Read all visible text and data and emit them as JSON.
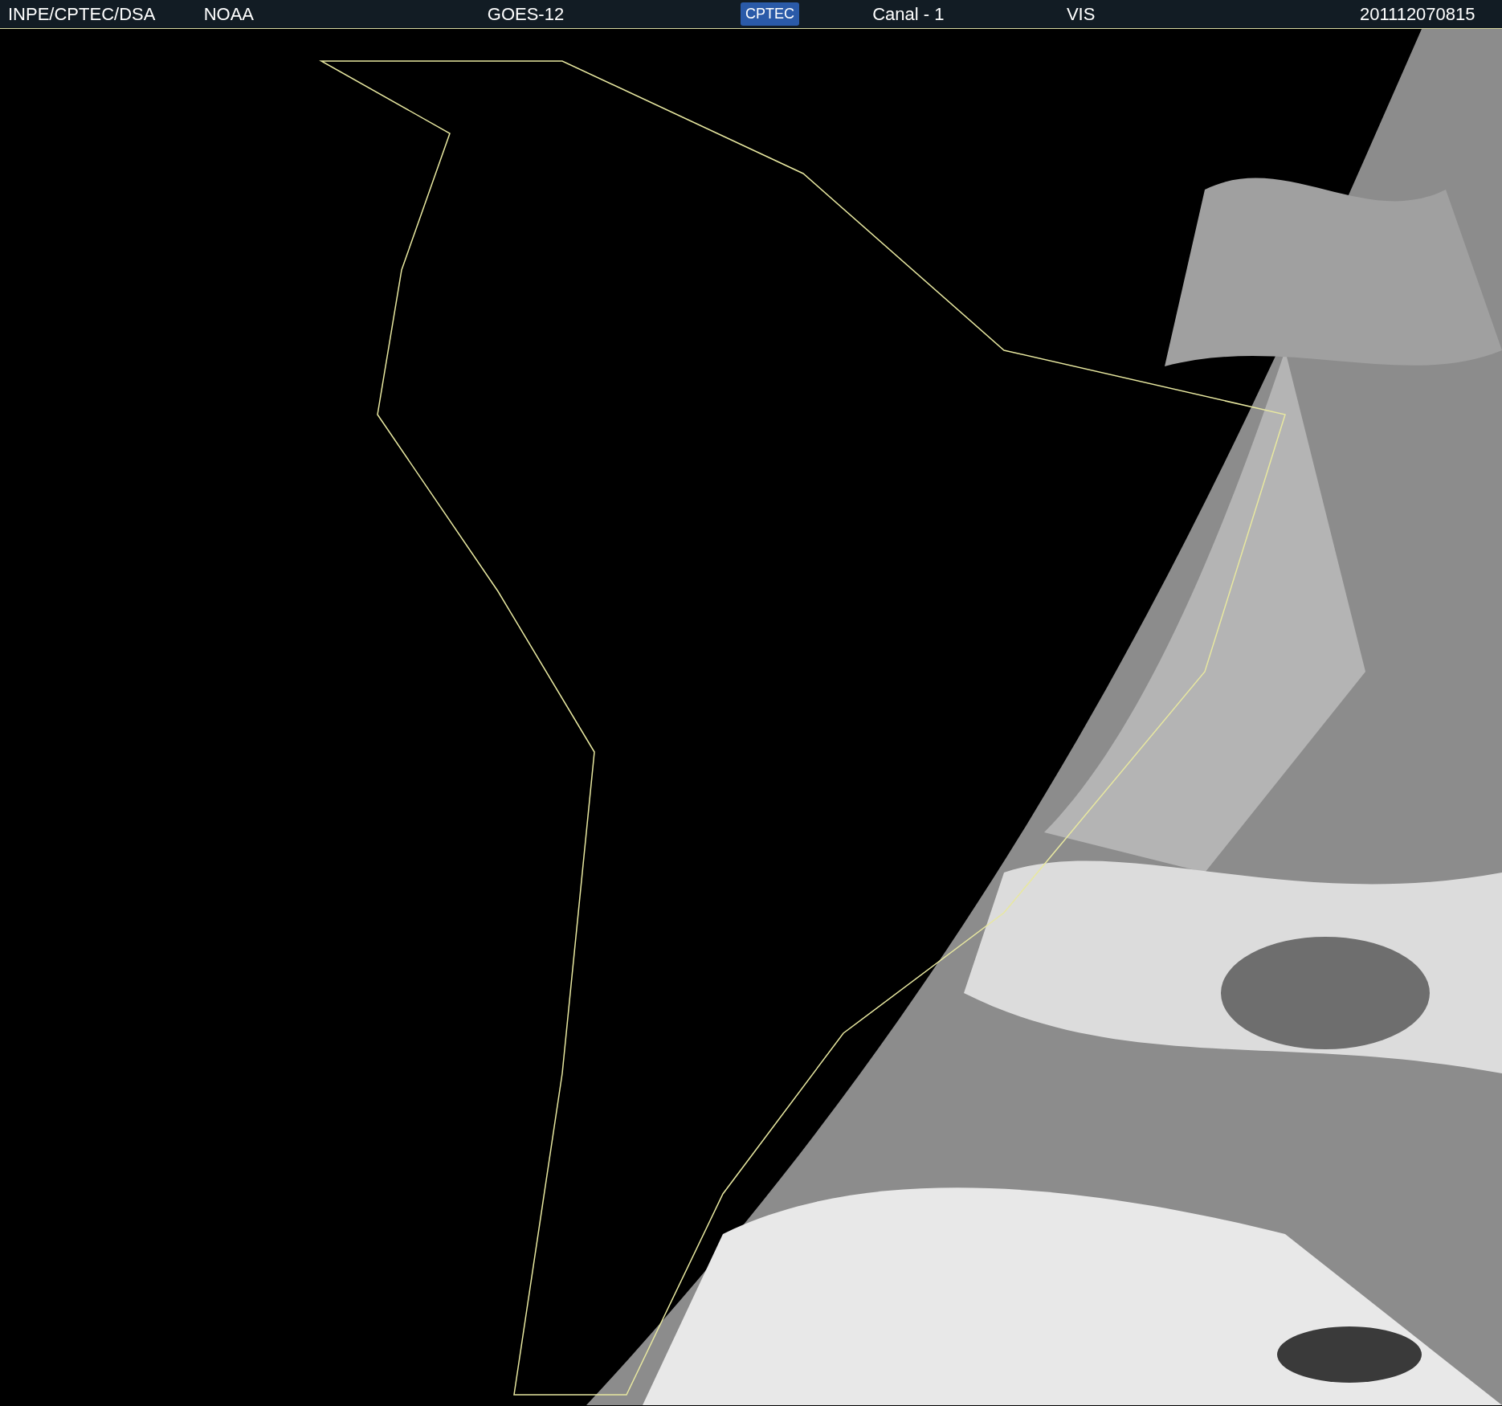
{
  "header": {
    "items": [
      {
        "kind": "text",
        "text": "INPE/CPTEC/DSA"
      },
      {
        "kind": "text",
        "text": "NOAA"
      },
      {
        "kind": "text",
        "text": "GOES-12"
      },
      {
        "kind": "logo",
        "text": "CPTEC"
      },
      {
        "kind": "text",
        "text": "Canal - 1"
      },
      {
        "kind": "text",
        "text": "VIS"
      },
      {
        "kind": "text",
        "text": "201112070815"
      }
    ]
  }
}
